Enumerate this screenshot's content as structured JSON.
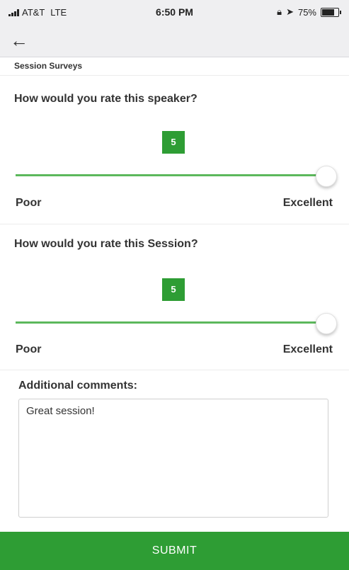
{
  "status_bar": {
    "carrier": "AT&T",
    "network": "LTE",
    "time": "6:50 PM",
    "battery": "75%",
    "battery_level": 0.75
  },
  "nav": {
    "back_icon": "back-arrow-icon"
  },
  "section_label": "Session Surveys",
  "questions": [
    {
      "prompt": "How would you rate this speaker?",
      "value": "5",
      "value_fraction": 1.0,
      "min_label": "Poor",
      "max_label": "Excellent"
    },
    {
      "prompt": "How would you rate this Session?",
      "value": "5",
      "value_fraction": 1.0,
      "min_label": "Poor",
      "max_label": "Excellent"
    }
  ],
  "comments": {
    "label": "Additional comments:",
    "value": "Great session!"
  },
  "submit_label": "SUBMIT",
  "colors": {
    "accent": "#2e9d34",
    "slider_track": "#5cb85c"
  }
}
